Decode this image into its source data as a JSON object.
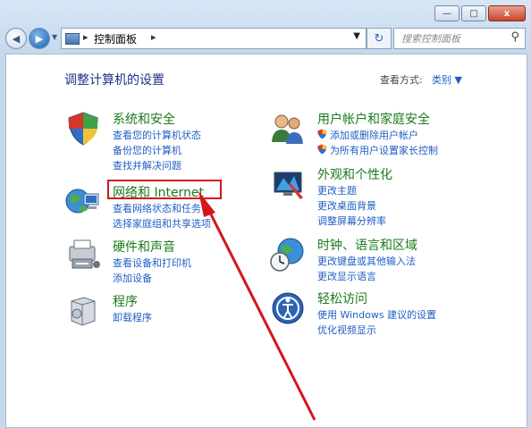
{
  "window": {
    "controls": {
      "minimize": "—",
      "maximize": "□",
      "close": "x"
    }
  },
  "navbar": {
    "breadcrumb": "控制面板",
    "search_placeholder": "搜索控制面板"
  },
  "header": {
    "title": "调整计算机的设置",
    "view_by_label": "查看方式:",
    "view_by_value": "类别 ▼"
  },
  "categories": [
    {
      "title": "系统和安全",
      "links": [
        "查看您的计算机状态",
        "备份您的计算机",
        "查找并解决问题"
      ]
    },
    {
      "title": "网络和 Internet",
      "links": [
        "查看网络状态和任务",
        "选择家庭组和共享选项"
      ]
    },
    {
      "title": "硬件和声音",
      "links": [
        "查看设备和打印机",
        "添加设备"
      ]
    },
    {
      "title": "程序",
      "links": [
        "卸载程序"
      ]
    },
    {
      "title": "用户帐户和家庭安全",
      "links": [
        "添加或删除用户帐户",
        "为所有用户设置家长控制"
      ]
    },
    {
      "title": "外观和个性化",
      "links": [
        "更改主题",
        "更改桌面背景",
        "调整屏幕分辨率"
      ]
    },
    {
      "title": "时钟、语言和区域",
      "links": [
        "更改键盘或其他输入法",
        "更改显示语言"
      ]
    },
    {
      "title": "轻松访问",
      "links": [
        "使用 Windows 建议的设置",
        "优化视频显示"
      ]
    }
  ],
  "annotation": {
    "color": "#d4161b"
  }
}
